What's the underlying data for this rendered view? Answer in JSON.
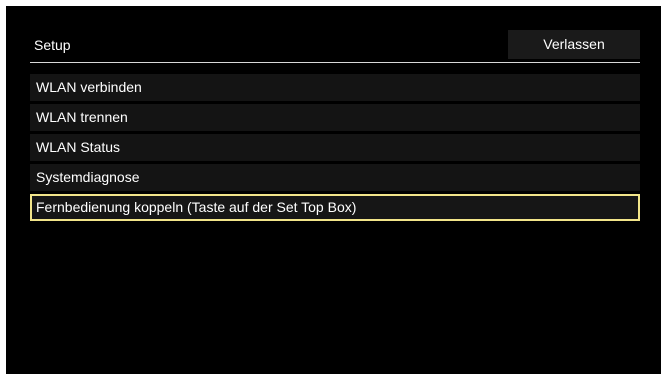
{
  "header": {
    "title": "Setup",
    "exit_label": "Verlassen"
  },
  "menu": {
    "items": [
      {
        "label": "WLAN verbinden",
        "selected": false
      },
      {
        "label": "WLAN trennen",
        "selected": false
      },
      {
        "label": "WLAN Status",
        "selected": false
      },
      {
        "label": "Systemdiagnose",
        "selected": false
      },
      {
        "label": "Fernbedienung koppeln (Taste auf der Set Top Box)",
        "selected": true
      }
    ]
  },
  "colors": {
    "background": "#000000",
    "item_background": "#141414",
    "selection_border": "#f2e58a",
    "text": "#ffffff"
  }
}
